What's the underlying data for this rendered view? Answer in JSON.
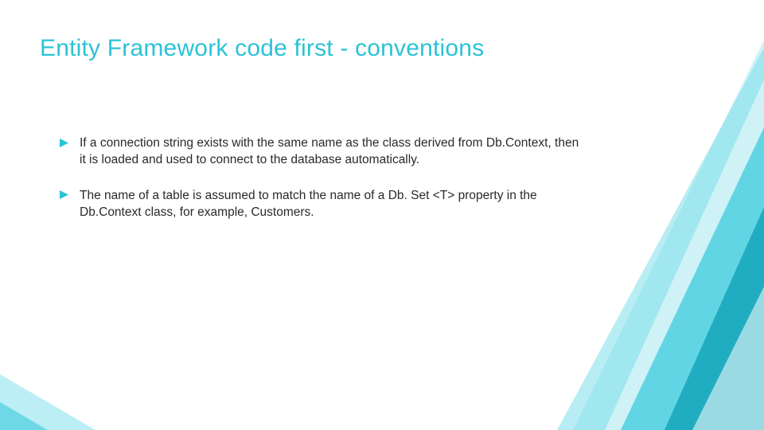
{
  "title": "Entity Framework code first - conventions",
  "bullets": [
    "If a connection string exists with the same name as the class derived from Db.Context, then it is loaded and used to connect to the database automatically.",
    "The name of a table is assumed to match the name of a Db. Set <T> property in the Db.Context class, for example, Customers."
  ],
  "colors": {
    "accent": "#2bc3d6",
    "bullet": "#2bc3d6",
    "text": "#2a2a2a"
  }
}
